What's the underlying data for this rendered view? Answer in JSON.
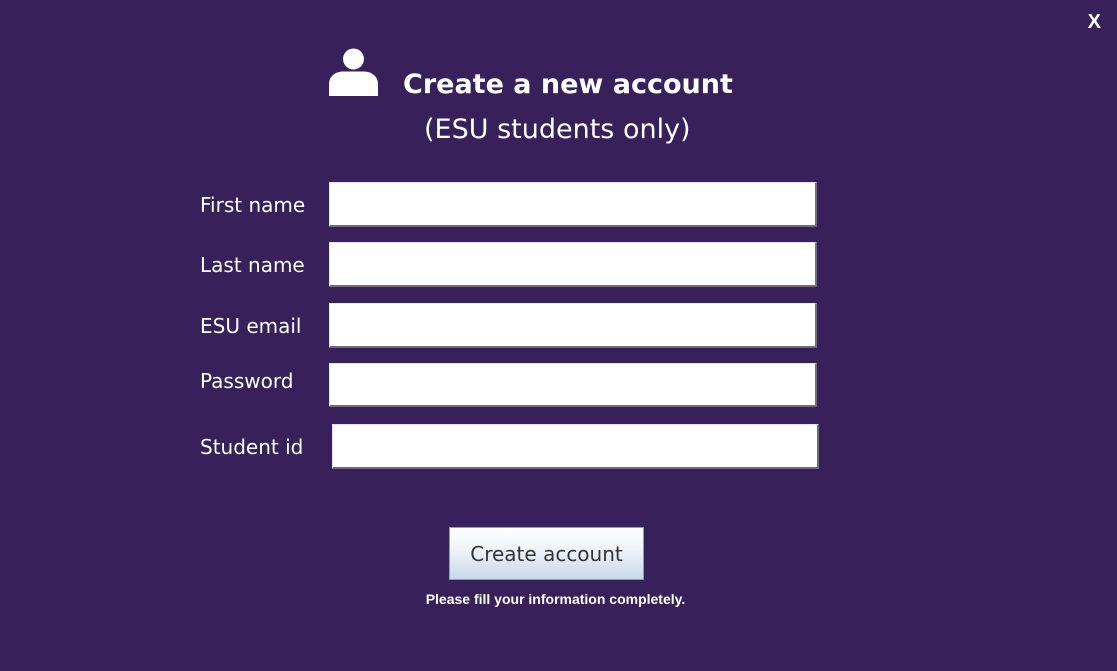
{
  "window": {
    "close_label": "X"
  },
  "header": {
    "icon": "user-icon",
    "title": "Create a new account",
    "subtitle": "(ESU students only)"
  },
  "form": {
    "fields": [
      {
        "label": "First name",
        "value": "",
        "placeholder": ""
      },
      {
        "label": "Last name",
        "value": "",
        "placeholder": ""
      },
      {
        "label": "ESU email",
        "value": "",
        "placeholder": ""
      },
      {
        "label": "Password",
        "value": "",
        "placeholder": ""
      },
      {
        "label": "Student id",
        "value": "",
        "placeholder": ""
      }
    ],
    "submit_label": "Create account",
    "hint": "Please fill your information completely."
  },
  "colors": {
    "background": "#38205a",
    "text": "#ffffff",
    "field_background": "#ffffff"
  }
}
